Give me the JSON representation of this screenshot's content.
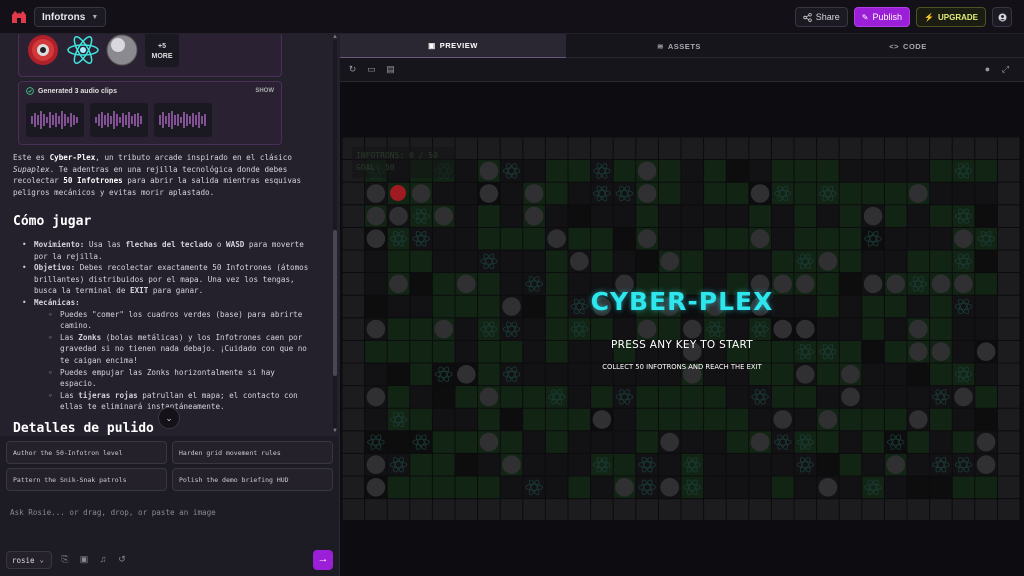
{
  "header": {
    "project_name": "Infotrons",
    "share_label": "Share",
    "publish_label": "Publish",
    "upgrade_label": "UPGRADE"
  },
  "chat": {
    "images": {
      "more_label": "+5\nMORE"
    },
    "audio": {
      "title": "Generated 3 audio clips",
      "show_label": "SHOW"
    },
    "intro_parts": {
      "p1": "Este es ",
      "p2": "Cyber-Plex",
      "p3": ", un tributo arcade inspirado en el clásico ",
      "p4": "Supaplex",
      "p5": ". Te adentras en una rejilla tecnológica donde debes recolectar ",
      "p6": "50 Infotrones",
      "p7": " para abrir la salida mientras esquivas peligros mecánicos y evitas morir aplastado."
    },
    "heading_how": "Cómo jugar",
    "b1_label": "Movimiento:",
    "b1_a": " Usa las ",
    "b1_b": "flechas del teclado",
    "b1_c": " o ",
    "b1_d": "WASD",
    "b1_e": " para moverte por la rejilla.",
    "b2_label": "Objetivo:",
    "b2_a": " Debes recolectar exactamente 50 Infotrones (átomos brillantes) distribuidos por el mapa. Una vez los tengas, busca la terminal de ",
    "b2_b": "EXIT",
    "b2_c": " para ganar.",
    "b3_label": "Mecánicas:",
    "s1": "Puedes \"comer\" los cuadros verdes (base) para abrirte camino.",
    "s2_a": "Las ",
    "s2_b": "Zonks",
    "s2_c": " (bolas metálicas) y los Infotrones caen por gravedad si no tienen nada debajo. ¡Cuidado con que no te caigan encima!",
    "s3": "Puedes empujar las Zonks horizontalmente si hay espacio.",
    "s4_a": "Las ",
    "s4_b": "tijeras rojas",
    "s4_c": " patrullan el mapa; el contacto con ellas te eliminará instantáneamente.",
    "heading_details": "Detalles de pulido"
  },
  "suggestions": [
    "Author the 50-Infotron level",
    "Harden grid movement rules",
    "Pattern the Snik-Snak patrols",
    "Polish the demo briefing HUD"
  ],
  "input": {
    "placeholder": "Ask Rosie... or drag, drop, or paste an image",
    "model": "rosie"
  },
  "preview": {
    "tabs": [
      "PREVIEW",
      "ASSETS",
      "CODE"
    ],
    "game_title": "CYBER-PLEX",
    "press_start": "PRESS ANY KEY TO START",
    "objective": "COLLECT 50 INFOTRONS AND REACH THE EXIT",
    "hud_infotrons": "INFOTRONS: 0 / 50",
    "hud_goal": "GOAL: 50"
  },
  "colors": {
    "accent": "#9b1fd6",
    "game_title": "#2ee6ee",
    "upgrade": "#e1ee74"
  }
}
